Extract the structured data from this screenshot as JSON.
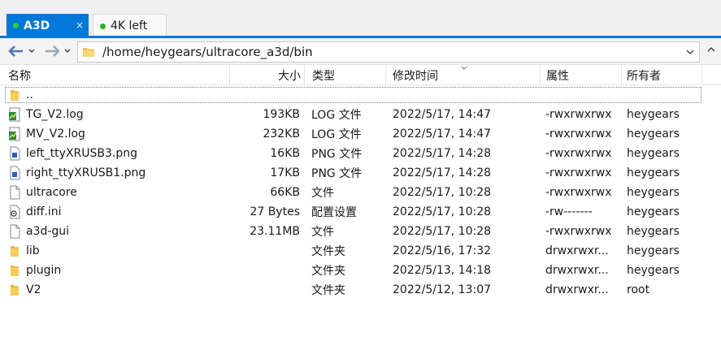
{
  "tabs": [
    {
      "label": "A3D",
      "active": true,
      "close": "×"
    },
    {
      "label": "4K left",
      "active": false
    }
  ],
  "address": {
    "path": "/home/heygears/ultracore_a3d/bin"
  },
  "columns": {
    "name": "名称",
    "size": "大小",
    "type": "类型",
    "modified": "修改时间",
    "permissions": "属性",
    "owner": "所有者"
  },
  "files": [
    {
      "name": "..",
      "size": "",
      "type": "",
      "modified": "",
      "permissions": "",
      "owner": "",
      "icon": "folder-icon"
    },
    {
      "name": "TG_V2.log",
      "size": "193KB",
      "type": "LOG 文件",
      "modified": "2022/5/17, 14:47",
      "permissions": "-rwxrwxrwx",
      "owner": "heygears",
      "icon": "log-file-icon"
    },
    {
      "name": "MV_V2.log",
      "size": "232KB",
      "type": "LOG 文件",
      "modified": "2022/5/17, 14:47",
      "permissions": "-rwxrwxrwx",
      "owner": "heygears",
      "icon": "log-file-icon"
    },
    {
      "name": "left_ttyXRUSB3.png",
      "size": "16KB",
      "type": "PNG 文件",
      "modified": "2022/5/17, 14:28",
      "permissions": "-rwxrwxrwx",
      "owner": "heygears",
      "icon": "image-file-icon"
    },
    {
      "name": "right_ttyXRUSB1.png",
      "size": "17KB",
      "type": "PNG 文件",
      "modified": "2022/5/17, 14:28",
      "permissions": "-rwxrwxrwx",
      "owner": "heygears",
      "icon": "image-file-icon"
    },
    {
      "name": "ultracore",
      "size": "66KB",
      "type": "文件",
      "modified": "2022/5/17, 10:28",
      "permissions": "-rwxrwxrwx",
      "owner": "heygears",
      "icon": "file-icon"
    },
    {
      "name": "diff.ini",
      "size": "27 Bytes",
      "type": "配置设置",
      "modified": "2022/5/17, 10:28",
      "permissions": "-rw-------",
      "owner": "heygears",
      "icon": "settings-file-icon"
    },
    {
      "name": "a3d-gui",
      "size": "23.11MB",
      "type": "文件",
      "modified": "2022/5/17, 10:28",
      "permissions": "-rwxrwxrwx",
      "owner": "heygears",
      "icon": "file-icon"
    },
    {
      "name": "lib",
      "size": "",
      "type": "文件夹",
      "modified": "2022/5/16, 17:32",
      "permissions": "drwxrwxr...",
      "owner": "heygears",
      "icon": "folder-icon"
    },
    {
      "name": "plugin",
      "size": "",
      "type": "文件夹",
      "modified": "2022/5/13, 14:18",
      "permissions": "drwxrwxr...",
      "owner": "heygears",
      "icon": "folder-icon"
    },
    {
      "name": "V2",
      "size": "",
      "type": "文件夹",
      "modified": "2022/5/12, 13:07",
      "permissions": "drwxrwxr...",
      "owner": "root",
      "icon": "folder-icon"
    }
  ],
  "colors": {
    "accent": "#0078d7",
    "folder": "#f5c451",
    "status_dot": "#1fb81f"
  }
}
